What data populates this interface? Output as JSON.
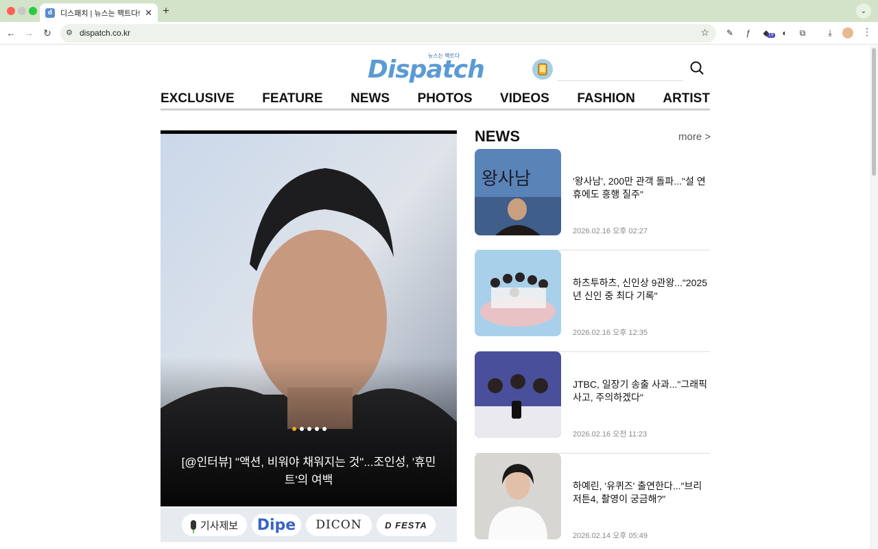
{
  "browser": {
    "tab_title": "디스패치 | 뉴스는 팩트다!",
    "url": "dispatch.co.kr",
    "extension_badge": "19"
  },
  "header": {
    "logo": "Dispatch",
    "logo_tagline": "뉴스는 팩트다",
    "search_placeholder": ""
  },
  "nav": [
    "EXCLUSIVE",
    "FEATURE",
    "NEWS",
    "PHOTOS",
    "VIDEOS",
    "FASHION",
    "ARTIST"
  ],
  "slide": {
    "title": "[@인터뷰] \"액션, 비워야 채워지는 것\"...조인성, '휴민트'의 여백",
    "dots": 5,
    "active_dot": 0
  },
  "quicklinks": {
    "report": "기사제보",
    "dipe": "Dipe",
    "dicon": "DICON",
    "festa": "D FESTA"
  },
  "news": {
    "heading": "NEWS",
    "more": "more >",
    "items": [
      {
        "title": "'왕사남', 200만 관객 돌파...\"설 연휴에도 흥행 질주\"",
        "date": "2026.02.16 오후 02:27"
      },
      {
        "title": "하츠투하츠, 신인상 9관왕...\"2025년 신인 중 최다 기록\"",
        "date": "2026.02.16 오후 12:35"
      },
      {
        "title": "JTBC, 일장기 송출 사과...\"그래픽 사고, 주의하겠다\"",
        "date": "2026.02.16 오전 11:23"
      },
      {
        "title": "하예린, '유퀴즈' 출연한다...\"브리저튼4, 촬영이 궁금해?\"",
        "date": "2026.02.14 오후 05:49"
      }
    ]
  },
  "colors": {
    "tabbar": "#d3e3c9",
    "logo_blue": "#5b9bd5",
    "active_dot": "#f5a623"
  }
}
